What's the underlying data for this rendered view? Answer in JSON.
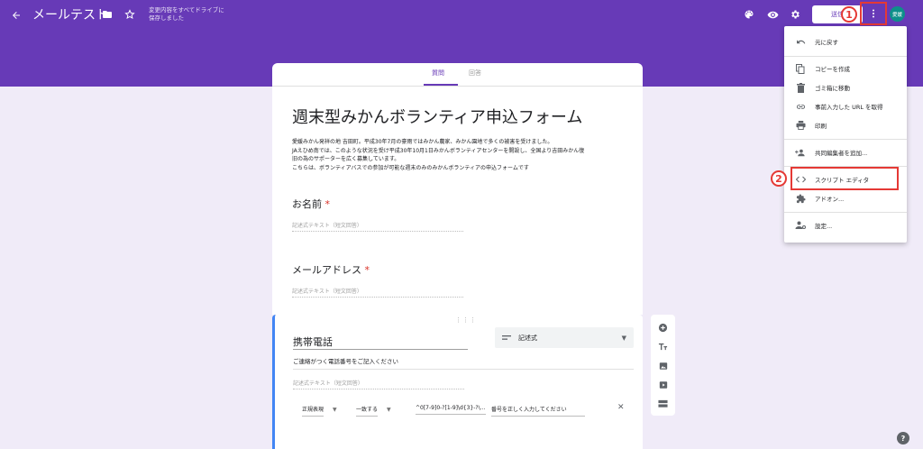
{
  "header": {
    "title": "メールテスト",
    "save_status": [
      "変更内容をすべてドライブに",
      "保存しました"
    ],
    "send_label": "送信",
    "avatar": "愛媛",
    "theme_color": "#673ab7",
    "icons": [
      "back-arrow-icon",
      "folder-icon",
      "star-icon",
      "palette-icon",
      "eye-icon",
      "gear-icon",
      "more-vert-icon"
    ]
  },
  "tabs": {
    "questions": "質問",
    "responses": "回答"
  },
  "form": {
    "title": "週末型みかんボランティア申込フォーム",
    "description": [
      "愛媛みかん発祥の地 吉田町。平成30年7月の豪雨ではみかん農家、みかん園地で多くの被害を受けました。",
      "JAえひめ南では、このような状況を受け平成30年10月1日みかんボランティアセンターを開設し、全国より吉田みかん復",
      "旧の為のサポーターを広く募集しています。",
      "こちらは、ボランティアバスでの参加が可能な週末のみのみかんボランティアの申込フォームです"
    ],
    "questions": [
      {
        "title": "お名前",
        "required": "*",
        "answer_placeholder": "記述式テキスト（短文回答）"
      },
      {
        "title": "メールアドレス",
        "required": "*",
        "answer_placeholder": "記述式テキスト（短文回答）"
      }
    ],
    "active_question": {
      "title": "携帯電話",
      "type": "記述式",
      "description": "ご連絡がつく電話番号をご記入ください",
      "answer_placeholder": "記述式テキスト（短文回答）",
      "validation": {
        "kind": "正規表現",
        "condition": "一致する",
        "pattern": "^0[7-9]0-?[1-9]\\d{3}-?\\...",
        "error_text": "番号を正しく入力してください"
      }
    }
  },
  "side_toolbar": [
    "add-question-icon",
    "add-title-icon",
    "add-image-icon",
    "add-video-icon",
    "add-section-icon"
  ],
  "menu": {
    "items": [
      {
        "label": "元に戻す",
        "icon": "undo-icon"
      },
      {
        "label": "コピーを作成",
        "icon": "copy-icon"
      },
      {
        "label": "ゴミ箱に移動",
        "icon": "trash-icon"
      },
      {
        "label": "事前入力した URL を取得",
        "icon": "link-icon"
      },
      {
        "label": "印刷",
        "icon": "print-icon"
      },
      {
        "label": "共同編集者を追加...",
        "icon": "add-people-icon"
      },
      {
        "label": "スクリプト エディタ",
        "icon": "code-icon"
      },
      {
        "label": "アドオン...",
        "icon": "puzzle-icon"
      },
      {
        "label": "設定...",
        "icon": "settings-person-icon"
      }
    ]
  },
  "annotations": {
    "step1": "1",
    "step2": "2",
    "highlight_color": "#e53935"
  },
  "help_label": "?"
}
